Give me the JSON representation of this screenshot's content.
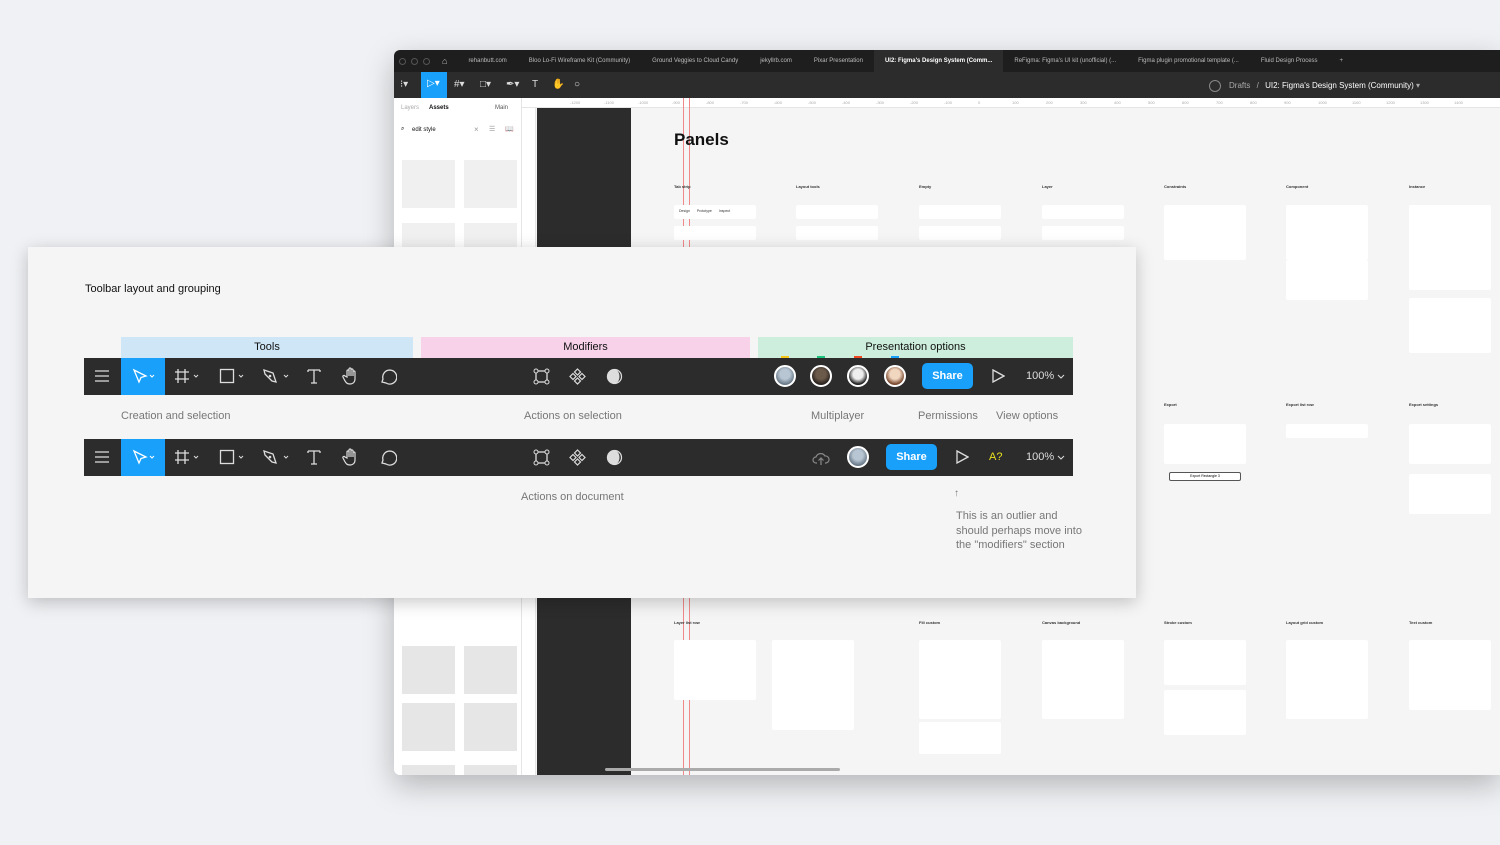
{
  "browser": {
    "tabs": [
      "rehanbutt.com",
      "Bloo Lo-Fi Wireframe Kit (Community)",
      "Ground Veggies to Cloud Candy",
      "jekyllrb.com",
      "Pixar Presentation",
      "UI2: Figma's Design System (Comm...",
      "ReFigma: Figma's UI kit (unofficial) (...",
      "Figma plugin promotional template (...",
      "Fluid Design Process",
      "+"
    ],
    "active_tab": 5
  },
  "figma": {
    "breadcrumb_drafts": "Drafts",
    "breadcrumb_sep": "/",
    "file_name": "UI2: Figma's Design System (Community)",
    "left_panel": {
      "tab_layers": "Layers",
      "tab_assets": "Assets",
      "page": "Main",
      "search_value": "edit style"
    },
    "ruler_ticks": [
      "-1200",
      "-1100",
      "-1000",
      "-900",
      "-800",
      "-700",
      "-600",
      "-500",
      "-400",
      "-300",
      "-200",
      "-100",
      "0",
      "100",
      "200",
      "300",
      "400",
      "500",
      "600",
      "700",
      "800",
      "900",
      "1000",
      "1100",
      "1200",
      "1300",
      "1400"
    ],
    "canvas": {
      "title": "Panels",
      "sections_top": [
        "Tab strip",
        "Layout tools",
        "Empty",
        "Layer",
        "Constraints",
        "Component",
        "Instance"
      ],
      "sections_mid": [
        "Export",
        "Export list row",
        "Export settings"
      ],
      "sections_bottom": [
        "Layer list row",
        "Fill custom",
        "Canvas background",
        "Stroke custom",
        "Layout grid custom",
        "Text custom"
      ],
      "tab_strip": [
        "Design",
        "Prototype",
        "Inspect"
      ],
      "export_button": "Export Rectangle 3"
    }
  },
  "overlay": {
    "title": "Toolbar layout and grouping",
    "sections": [
      {
        "label": "Tools",
        "color": "#cfe6f7"
      },
      {
        "label": "Modifiers",
        "color": "#f7d2e8"
      },
      {
        "label": "Presentation options",
        "color": "#cdeedd"
      }
    ],
    "row1_labels": {
      "creation": "Creation and selection",
      "actions_selection": "Actions on selection",
      "multiplayer": "Multiplayer",
      "permissions": "Permissions",
      "view": "View options"
    },
    "row2_labels": {
      "actions_document": "Actions on document",
      "arrow": "↑",
      "note_lines": [
        "This is an outlier and",
        "should perhaps move into",
        "the \"modifiers\" section"
      ]
    },
    "toolbar": {
      "share": "Share",
      "zoom": "100%",
      "ai": "A?",
      "accent": "#18a0fb",
      "bg": "#2c2c2c"
    },
    "presence_colors": [
      "#f5c518",
      "#1bc47d",
      "#f24822",
      "#18a0fb"
    ]
  }
}
